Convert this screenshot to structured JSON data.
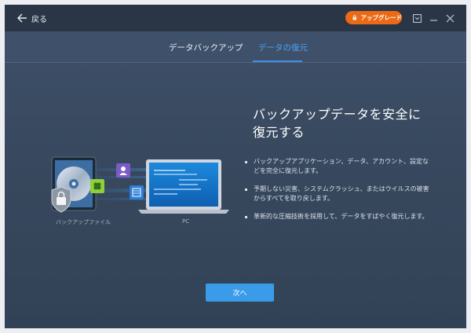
{
  "titlebar": {
    "back_label": "戻る",
    "upgrade_label": "アップグレード",
    "accent": "#ec6a16"
  },
  "tabs": [
    {
      "label": "データバックアップ",
      "active": false
    },
    {
      "label": "データの復元",
      "active": true
    }
  ],
  "tab_accent": "#3f8ee5",
  "illustration": {
    "left_caption": "バックアップファイル",
    "right_caption": "PC"
  },
  "content": {
    "headline": "バックアップデータを安全に復元する",
    "bullets": [
      "バックアップアプリケーション、データ、アカウント、設定などを完全に復元します。",
      "予期しない災害、システムクラッシュ、またはウイルスの被害からすべてを取り戻します。",
      "革新的な圧縮技術を採用して、データをすばやく復元します。"
    ]
  },
  "next_button": {
    "label": "次へ",
    "color": "#3a9be8"
  }
}
